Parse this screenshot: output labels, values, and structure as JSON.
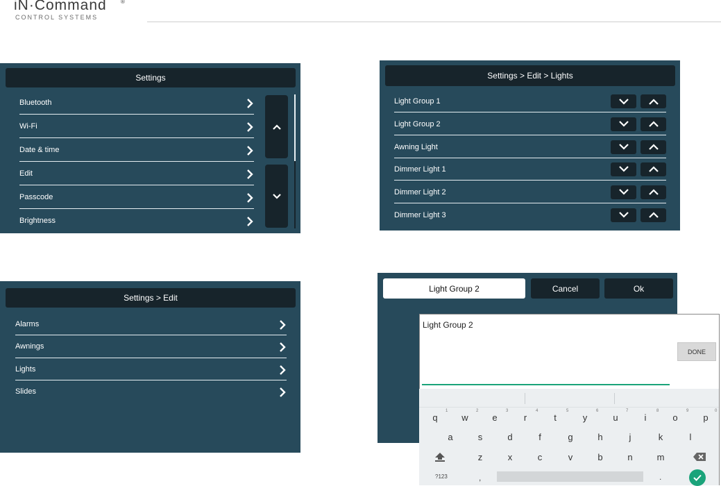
{
  "brand": {
    "name": "iN·Command",
    "tagline": "CONTROL SYSTEMS",
    "reg": "®"
  },
  "settings": {
    "title": "Settings",
    "items": [
      "Bluetooth",
      "Wi-Fi",
      "Date & time",
      "Edit",
      "Passcode",
      "Brightness"
    ]
  },
  "edit": {
    "title": "Settings > Edit",
    "items": [
      "Alarms",
      "Awnings",
      "Lights",
      "Slides"
    ]
  },
  "lights": {
    "title": "Settings > Edit > Lights",
    "items": [
      "Light Group 1",
      "Light Group 2",
      "Awning Light",
      "Dimmer Light 1",
      "Dimmer Light 2",
      "Dimmer Light 3"
    ]
  },
  "rename": {
    "name_value": "Light Group 2",
    "cancel_label": "Cancel",
    "ok_label": "Ok",
    "input_text": "Light Group 2",
    "done_label": "DONE"
  },
  "keyboard": {
    "row1": [
      "q",
      "w",
      "e",
      "r",
      "t",
      "y",
      "u",
      "i",
      "o",
      "p"
    ],
    "row1_hints": [
      "1",
      "2",
      "3",
      "4",
      "5",
      "6",
      "7",
      "8",
      "9",
      "0"
    ],
    "row2": [
      "a",
      "s",
      "d",
      "f",
      "g",
      "h",
      "j",
      "k",
      "l"
    ],
    "row3": [
      "z",
      "x",
      "c",
      "v",
      "b",
      "n",
      "m"
    ],
    "symbols_label": "?123",
    "comma": ",",
    "period": "."
  },
  "colors": {
    "panel": "#274a5b",
    "titlebar": "#17242b",
    "accent": "#1aa37a"
  },
  "icons": [
    "chevron-right-icon",
    "chevron-up-icon",
    "chevron-down-icon",
    "shift-icon",
    "backspace-icon",
    "checkmark-icon"
  ]
}
